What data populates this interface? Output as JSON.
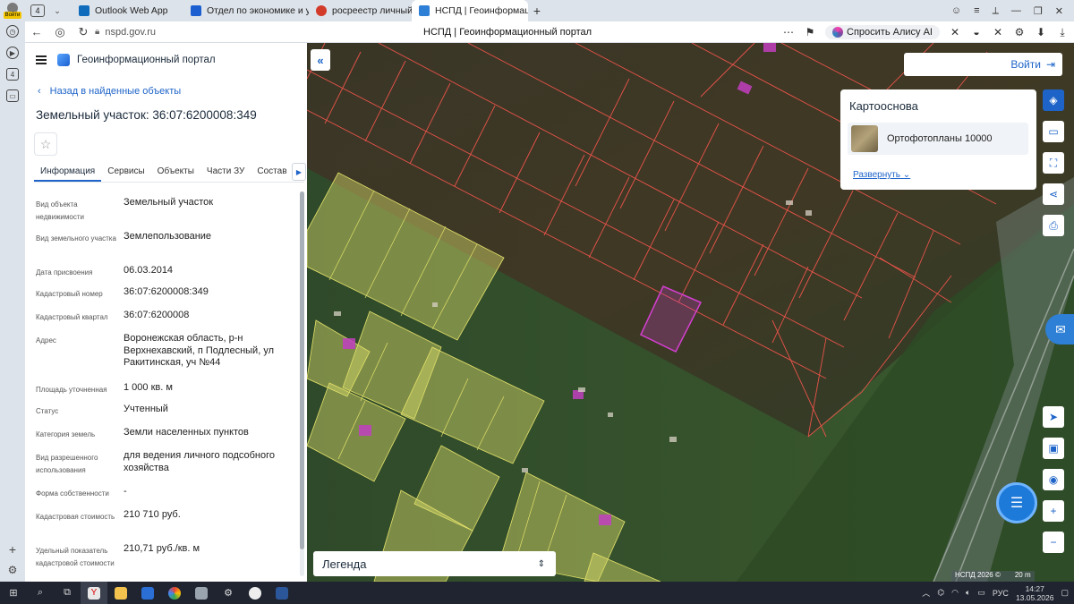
{
  "browser": {
    "profile_label": "Войти",
    "tab_count": "4",
    "tabs": [
      {
        "title": "Outlook Web App",
        "color": "#0f6cbd"
      },
      {
        "title": "Отдел по экономике и уп",
        "color": "#1b5fd1"
      },
      {
        "title": "росреестр личный кабин",
        "color": "#d23a2a"
      },
      {
        "title": "НСПД | Геоинформаци",
        "color": "#2e7fd6"
      }
    ],
    "active_tab_index": 3,
    "url": "nspd.gov.ru",
    "page_title": "НСПД | Геоинформационный портал",
    "alice_label": "Спросить Алису AI",
    "side_count": "4"
  },
  "portal": {
    "app_title": "Геоинформационный портал",
    "back_label": "Назад в найденные объекты",
    "object_title": "Земельный участок: 36:07:6200008:349",
    "tabs": [
      "Информация",
      "Сервисы",
      "Объекты",
      "Части ЗУ",
      "Состав"
    ],
    "active_tab": 0,
    "properties": [
      {
        "label": "Вид объекта недвижимости",
        "value": "Земельный участок"
      },
      {
        "label": "Вид земельного участка",
        "value": "Землепользование"
      },
      {
        "label": "Дата присвоения",
        "value": "06.03.2014"
      },
      {
        "label": "Кадастровый номер",
        "value": "36:07:6200008:349"
      },
      {
        "label": "Кадастровый квартал",
        "value": "36:07:6200008"
      },
      {
        "label": "Адрес",
        "value": "Воронежская область, р-н Верхнехавский, п Подлесный, ул Ракитинская, уч №44"
      },
      {
        "label": "Площадь уточненная",
        "value": "1 000 кв. м"
      },
      {
        "label": "Статус",
        "value": "Учтенный"
      },
      {
        "label": "Категория земель",
        "value": "Земли населенных пунктов"
      },
      {
        "label": "Вид разрешенного использования",
        "value": "для ведения личного подсобного хозяйства"
      },
      {
        "label": "Форма собственности",
        "value": "-"
      },
      {
        "label": "Кадастровая стоимость",
        "value": "210 710 руб."
      },
      {
        "label": "Удельный показатель кадастровой стоимости",
        "value": "210,71 руб./кв. м"
      }
    ]
  },
  "map": {
    "login_label": "Войти",
    "basemap_title": "Картооснова",
    "basemap_item": "Ортофотопланы 10000",
    "expand_label": "Развернуть",
    "legend_label": "Легенда",
    "attribution": "НСПД 2026 ©",
    "scale": "20 m",
    "colors": {
      "parcel_line": "#e8534a",
      "zone_fill": "#d9dc6a",
      "selected": "#d43fd0",
      "accent": "#1e64c8"
    }
  },
  "taskbar": {
    "lang": "РУС",
    "time": "14:27",
    "date": "13.05.2026"
  }
}
